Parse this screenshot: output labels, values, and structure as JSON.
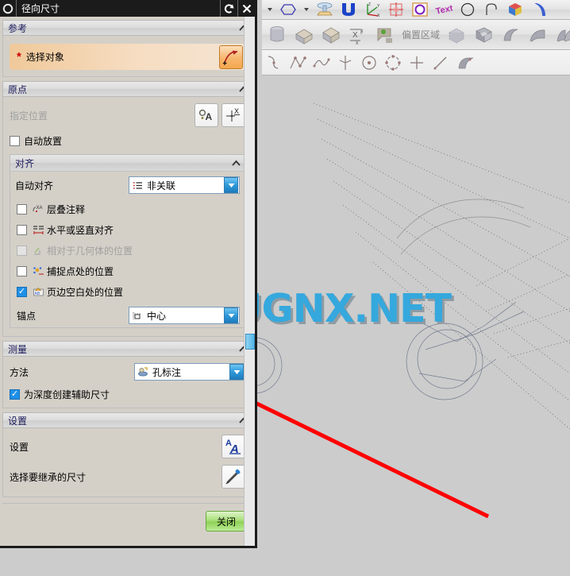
{
  "window": {
    "title": "径向尺寸",
    "icon": "gear-icon",
    "reset_icon": "reset-arrow-icon",
    "close_icon": "close-x-icon"
  },
  "watermark": {
    "text": "WWW.UGNX.NET",
    "color": "#35a8dd",
    "shadow_color": "#8f9ba3"
  },
  "colors": {
    "dialog_bg": "#d4d0c8",
    "section_title": "#1c1c5e",
    "highlight_row": "#f0c99a",
    "accent_blue": "#2e9ada",
    "close_button_green": "#8ed257",
    "asterisk_red": "#cc0000",
    "arrow_red": "#ff0000",
    "canvas_bg": "#cccccc"
  },
  "sections": {
    "reference": {
      "title": "参考",
      "collapse_icon": "chevron-up-icon",
      "select_object": {
        "label": "选择对象",
        "required_marker": "*",
        "button_icon": "radius-dimension-icon"
      }
    },
    "origin": {
      "title": "原点",
      "collapse_icon": "chevron-up-icon",
      "specify_location": {
        "label": "指定位置",
        "enabled": false,
        "buttons": [
          {
            "name": "point-annotation-button",
            "icon": "point-a-icon"
          },
          {
            "name": "xy-coordinate-button",
            "icon": "xy-axis-icon"
          }
        ]
      },
      "auto_place": {
        "label": "自动放置",
        "checked": false
      },
      "alignment": {
        "title": "对齐",
        "collapse_icon": "chevron-up-icon",
        "auto_align": {
          "label": "自动对齐",
          "value": "非关联",
          "icon": "list-align-icon"
        },
        "options": [
          {
            "label": "层叠注释",
            "checked": false,
            "enabled": true,
            "icon": "stacked-annotation-icon"
          },
          {
            "label": "水平或竖直对齐",
            "checked": false,
            "enabled": true,
            "icon": "horizontal-vertical-align-icon"
          },
          {
            "label": "相对于几何体的位置",
            "checked": false,
            "enabled": false,
            "icon": "relative-geometry-icon"
          },
          {
            "label": "捕捉点处的位置",
            "checked": false,
            "enabled": true,
            "icon": "snap-point-icon"
          },
          {
            "label": "页边空白处的位置",
            "checked": true,
            "enabled": true,
            "icon": "margin-position-icon"
          }
        ],
        "anchor_point": {
          "label": "锚点",
          "value": "中心",
          "icon": "anchor-center-icon"
        }
      }
    },
    "measure": {
      "title": "测量",
      "collapse_icon": "chevron-up-icon",
      "method": {
        "label": "方法",
        "value": "孔标注",
        "icon": "hole-callout-icon"
      },
      "depth_aux": {
        "label": "为深度创建辅助尺寸",
        "checked": true
      }
    },
    "settings": {
      "title": "设置",
      "collapse_icon": "chevron-up-icon",
      "rows": [
        {
          "label": "设置",
          "button_name": "text-settings-button",
          "icon": "font-AA-icon"
        },
        {
          "label": "选择要继承的尺寸",
          "button_name": "inherit-dimension-button",
          "icon": "eyedropper-icon"
        }
      ]
    }
  },
  "footer": {
    "close_label": "关闭"
  },
  "toolbars": {
    "row1": [
      {
        "name": "dropdown-arrow-1",
        "icon": "caret-down-icon"
      },
      {
        "name": "hexagon-tool",
        "icon": "hexagon-icon"
      },
      {
        "name": "dropdown-arrow-2",
        "icon": "caret-down-icon"
      },
      {
        "name": "emboss-tool",
        "icon": "emboss-icon"
      },
      {
        "name": "groove-tool",
        "icon": "u-groove-icon"
      },
      {
        "name": "datum-csys-tool",
        "icon": "csys-axes-icon"
      },
      {
        "name": "center-mark-tool",
        "icon": "center-mark-icon"
      },
      {
        "name": "circle-annotation-tool",
        "icon": "purple-circle-icon"
      },
      {
        "name": "text-tool",
        "icon": "text-icon"
      },
      {
        "name": "circle-tool",
        "icon": "circle-outline-icon"
      },
      {
        "name": "hook-tool",
        "icon": "hook-curve-icon"
      },
      {
        "name": "color-cube-tool",
        "icon": "color-cube-icon"
      },
      {
        "name": "edge-tool",
        "icon": "blue-edge-icon"
      }
    ],
    "row2": [
      {
        "name": "cylinder-tool",
        "icon": "cylinder-icon"
      },
      {
        "name": "block-bevel-tool",
        "icon": "beveled-block-icon"
      },
      {
        "name": "block-tool",
        "icon": "block-icon"
      },
      {
        "name": "xx-dimension-tool",
        "icon": "x-x-dimension-icon"
      },
      {
        "name": "region-flag-tool",
        "icon": "flag-region-icon"
      },
      {
        "name": "offset-region-label",
        "icon": "text-label",
        "label": "偏置区域"
      },
      {
        "name": "dashed-box-tool",
        "icon": "dashed-box-icon"
      },
      {
        "name": "hollow-block-tool",
        "icon": "hollow-block-icon"
      },
      {
        "name": "sheet-tool",
        "icon": "curved-sheet-icon"
      },
      {
        "name": "surface-tool",
        "icon": "surface-icon"
      },
      {
        "name": "ruled-surface-tool",
        "icon": "ruled-surface-icon"
      }
    ],
    "row3": [
      {
        "name": "curve-1-tool",
        "icon": "curve-hook-icon"
      },
      {
        "name": "polyline-point-tool",
        "icon": "polyline-points-icon"
      },
      {
        "name": "spline-tool",
        "icon": "spline-icon"
      },
      {
        "name": "axis-tool",
        "icon": "axis-cross-icon"
      },
      {
        "name": "circle-center-tool",
        "icon": "circle-with-center-icon"
      },
      {
        "name": "circle-quad-tool",
        "icon": "circle-quadrant-icon"
      },
      {
        "name": "plus-point-tool",
        "icon": "plus-point-icon"
      },
      {
        "name": "line-point-tool",
        "icon": "line-segment-icon"
      },
      {
        "name": "sheet-body-tool",
        "icon": "sheet-body-icon"
      }
    ]
  }
}
